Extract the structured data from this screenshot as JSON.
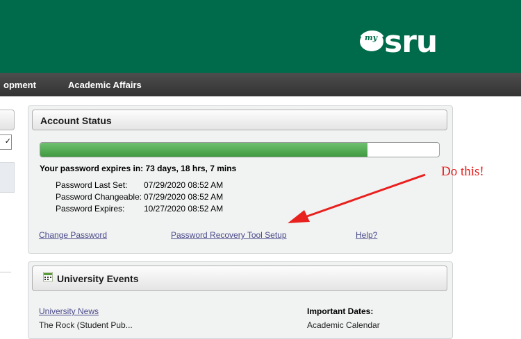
{
  "header": {
    "logo_my": "my",
    "logo_sru": "sru",
    "brand_color": "#006b4a"
  },
  "nav": {
    "items": [
      "opment",
      "Academic Affairs"
    ]
  },
  "left_strip": {
    "select_value": "✓"
  },
  "account_status": {
    "title": "Account Status",
    "progress_fraction": 0.82,
    "expires_label": "Your password expires in: 73 days, 18 hrs, 7 mins",
    "rows": [
      {
        "label": "Password Last Set:",
        "value": "07/29/2020 08:52 AM"
      },
      {
        "label": "Password Changeable:",
        "value": "07/29/2020 08:52 AM"
      },
      {
        "label": "Password Expires:",
        "value": "10/27/2020 08:52 AM"
      }
    ],
    "links": {
      "change_password": "Change Password",
      "recovery_tool": "Password Recovery Tool Setup",
      "help": "Help?"
    }
  },
  "university_events": {
    "title": "University Events",
    "icon": "calendar-icon",
    "news_link": "University News",
    "important_dates": "Important Dates:",
    "cut_left": "The Rock (Student Pub...",
    "cut_right": "Academic Calendar"
  },
  "annotation": {
    "text": "Do this!",
    "color": "#e8201e"
  }
}
